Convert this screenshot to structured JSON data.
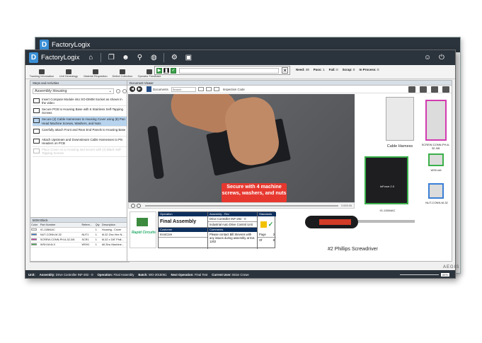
{
  "app": {
    "logo_letter": "D",
    "name": "FactoryLogix"
  },
  "toolbar": [
    "Tracking Information",
    "Unit Genealogy",
    "Material Requisition",
    "Defect Collection",
    "Operator Feedback"
  ],
  "counts": {
    "need_label": "Need:",
    "need": "49",
    "pass_label": "Pass:",
    "pass": "1",
    "fail_label": "Fail:",
    "fail": "0",
    "scrap_label": "Scrap:",
    "scrap": "0",
    "inproc_label": "In Process:",
    "inproc": "0"
  },
  "left_panel": {
    "header": "Steps and Activities",
    "assembly": "Assembly Housing",
    "steps": [
      "Insert Compute Module into SO-DIMM Socket as shown in the video",
      "Secure PCB to Housing Base with 6 Stainless Self-Tapping Screws",
      "Secure (2) Cable Harnesses to Housing Cover using (8) Pan Head Machine Screws, Washers, and Nuts",
      "Carefully attach Front and Rear End Panels to Housing Base",
      "Attach Upstream and Downstream Cable Harnesses to Pin Headers on PCB",
      "Place Cover on to Housing and secure with (4) Black Self-Tapping Screws"
    ]
  },
  "bom": {
    "header": "BOM Block",
    "columns": [
      "Color",
      "Part Number",
      "Refere...",
      "Qty",
      "Description"
    ],
    "rows": [
      {
        "color": "#ffffff",
        "part": "IG-11584AC",
        "ref": "",
        "qty": "1",
        "desc": "Housing - Cover"
      },
      {
        "color": "#3a7fd6",
        "part": "NUT-CONN-M-32",
        "ref": "NUT1",
        "qty": "1",
        "desc": "M-32 Zinc Hex N..."
      },
      {
        "color": "#d33bb0",
        "part": "SCREW-CONN-PH-6-32-3/8",
        "ref": "SCR1",
        "qty": "1",
        "desc": "M-32 x 3/8\" Phill..."
      },
      {
        "color": "#3ab04a",
        "part": "WSH-M-6LX",
        "ref": "WSH1",
        "qty": "1",
        "desc": "#6 Zinc Machine..."
      }
    ]
  },
  "viewer": {
    "header": "Document Viewer",
    "documents_label": "Documents",
    "search_placeholder": "Search",
    "inspection_label": "Inspection Code",
    "callout": "Secure with 4 machine screws, washers, and nuts",
    "time": "0:00/0:06",
    "images": {
      "cable_harness": "Cable Harness",
      "screw": "SCREW-CONN-PH-6-32-3/8",
      "washer": "WSH-#6",
      "nut": "NUT-CONN-M-32",
      "cover_part": "IG-11584AC",
      "cover_desc": "(Housing Cover)",
      "cover_brand": "inForce 2.0"
    },
    "info": {
      "operation_hdr": "Operation",
      "operation": "Final Assembly",
      "customer_hdr": "Customer",
      "customer": "InnoCore",
      "assembly_hdr": "Assembly - Rev",
      "assembly": "Drive Controller INF-202 - 0",
      "assembly_desc": "Industrial Auto Drive Control Unit",
      "comments_hdr": "Comments",
      "comments": "Please contact Bill Stevens with any issues during assembly at Ext. 1202",
      "standards_hdr": "Standards",
      "page_label": "Page",
      "page": "2",
      "of_label": "Of",
      "of": "8",
      "logo_name": "Rapid Circuits"
    },
    "driver_label": "#2 Phillips Screwdriver"
  },
  "status": {
    "unit_label": "Unit:",
    "unit": "",
    "assembly_label": "Assembly:",
    "assembly": "Drive Controller INF-202 - 0",
    "operation_label": "Operation:",
    "operation": "Final Assembly",
    "batch_label": "Batch:",
    "batch": "WO-2018061",
    "next_label": "Next Operation:",
    "next": "Final Test",
    "user_label": "Current User:",
    "user": "Brian Crowe",
    "zoom": "84%"
  },
  "brand": "AEGIS"
}
